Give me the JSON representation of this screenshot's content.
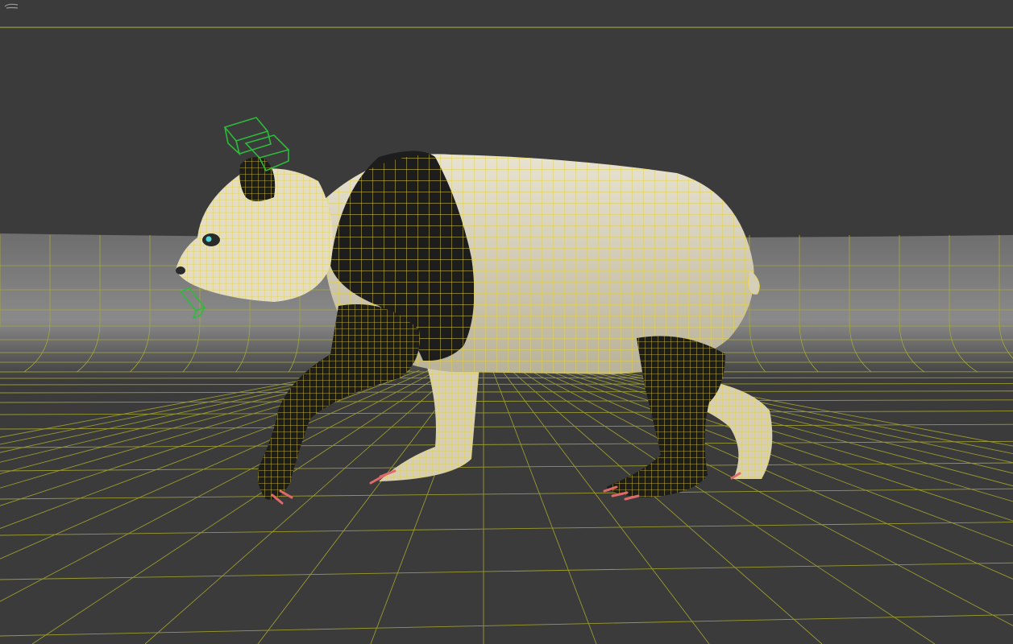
{
  "viewport": {
    "label": "",
    "mode": "shaded-with-wireframe-on-shaded",
    "model": "panda-mesh"
  },
  "colors": {
    "background": "#3b3b3b",
    "grid_line": "#9a9a30",
    "wireframe": "#e6d23c",
    "selection_handle": "#2dbb3a",
    "fur_light": "#d9d3bf",
    "fur_dark": "#1d1d1d",
    "claws": "#e06a6a",
    "eye": "#4fd6d6"
  },
  "icons": {
    "nav_gizmo": "view-cube-icon"
  }
}
